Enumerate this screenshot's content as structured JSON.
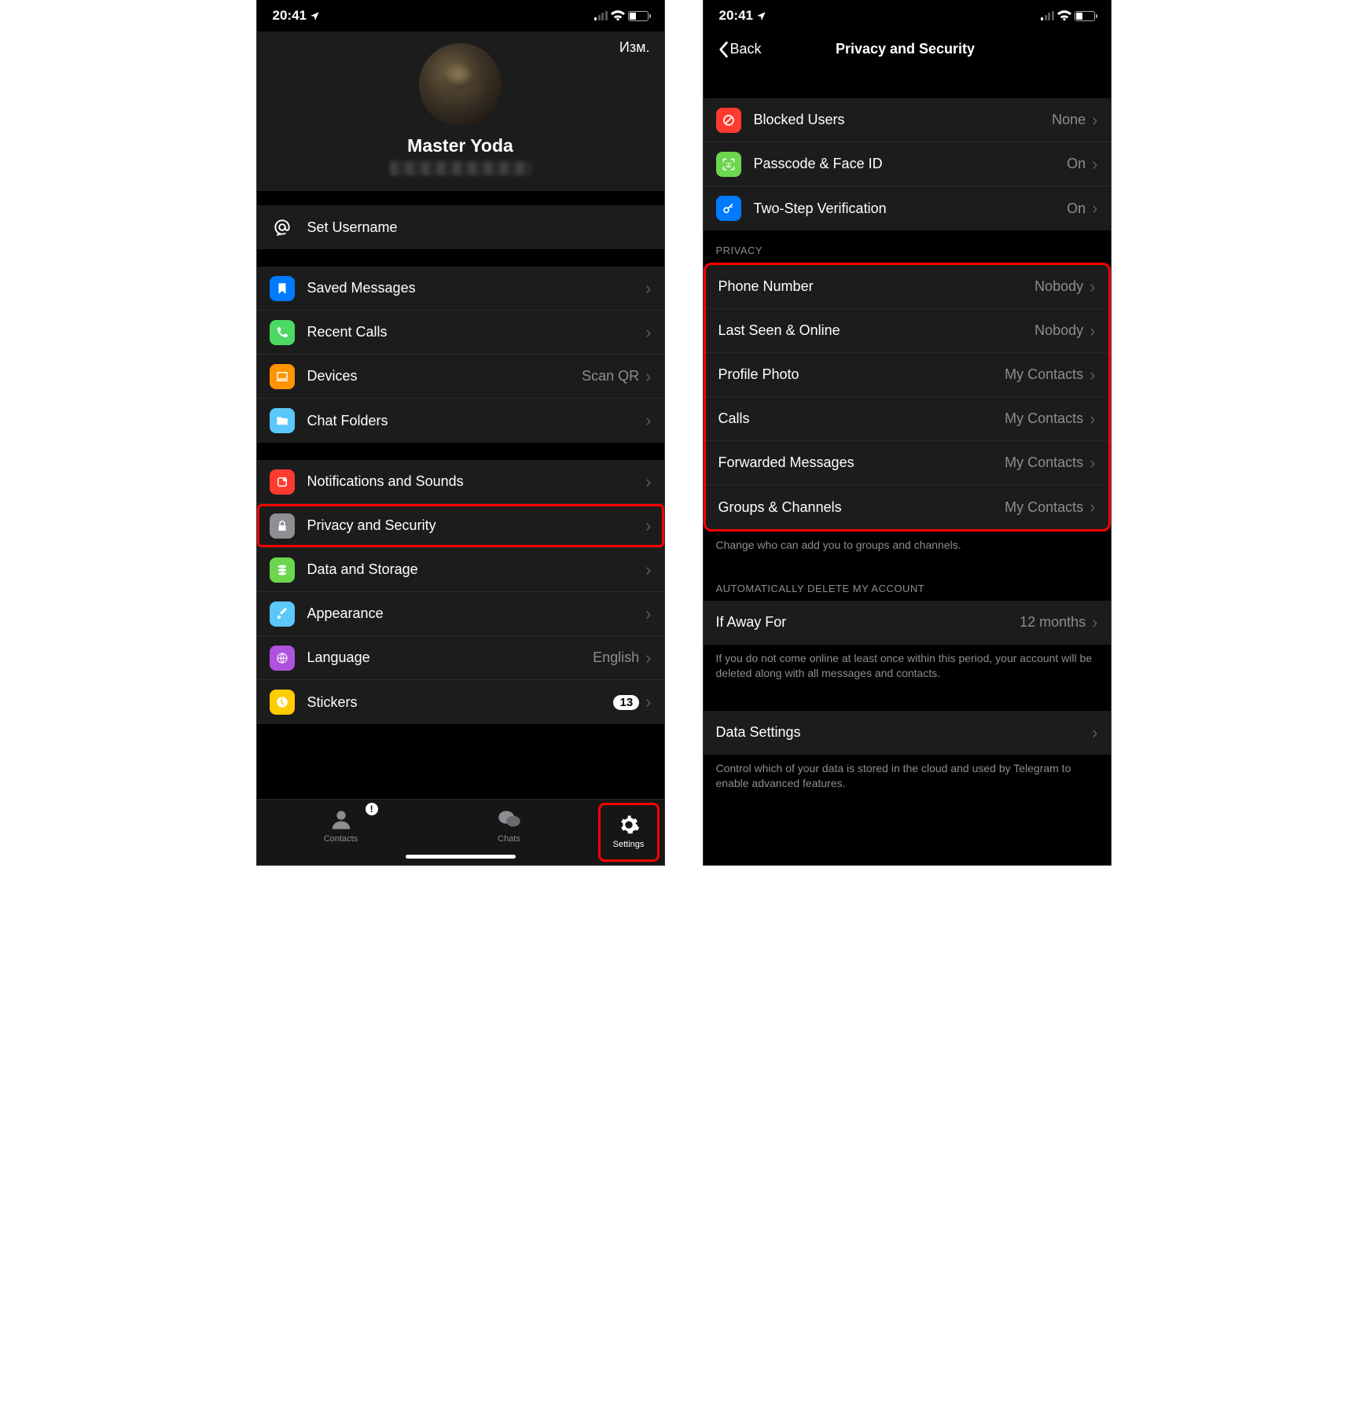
{
  "status": {
    "time": "20:41"
  },
  "left_screen": {
    "edit_label": "Изм.",
    "profile_name": "Master Yoda",
    "set_username": "Set Username",
    "group1": [
      {
        "icon": "bookmark-icon",
        "color": "bg-blue",
        "label": "Saved Messages"
      },
      {
        "icon": "phone-icon",
        "color": "bg-green",
        "label": "Recent Calls"
      },
      {
        "icon": "laptop-icon",
        "color": "bg-orange",
        "label": "Devices",
        "value": "Scan QR"
      },
      {
        "icon": "folder-icon",
        "color": "bg-cyan",
        "label": "Chat Folders"
      }
    ],
    "group2": [
      {
        "icon": "bell-icon",
        "color": "bg-red",
        "label": "Notifications and Sounds"
      },
      {
        "icon": "lock-icon",
        "color": "bg-gray",
        "label": "Privacy and Security",
        "highlight": true
      },
      {
        "icon": "database-icon",
        "color": "bg-lime",
        "label": "Data and Storage"
      },
      {
        "icon": "brush-icon",
        "color": "bg-cyan",
        "label": "Appearance"
      },
      {
        "icon": "globe-icon",
        "color": "bg-purple",
        "label": "Language",
        "value": "English"
      },
      {
        "icon": "pie-icon",
        "color": "bg-yellow",
        "label": "Stickers",
        "badge": "13"
      }
    ],
    "tabs": {
      "contacts": "Contacts",
      "chats": "Chats",
      "settings": "Settings"
    }
  },
  "right_screen": {
    "back_label": "Back",
    "title": "Privacy and Security",
    "group_security": [
      {
        "icon": "block-icon",
        "color": "bg-red",
        "label": "Blocked Users",
        "value": "None"
      },
      {
        "icon": "faceid-icon",
        "color": "bg-lime",
        "label": "Passcode & Face ID",
        "value": "On"
      },
      {
        "icon": "key-icon",
        "color": "bg-blue",
        "label": "Two-Step Verification",
        "value": "On"
      }
    ],
    "privacy_header": "PRIVACY",
    "group_privacy": [
      {
        "label": "Phone Number",
        "value": "Nobody"
      },
      {
        "label": "Last Seen & Online",
        "value": "Nobody"
      },
      {
        "label": "Profile Photo",
        "value": "My Contacts"
      },
      {
        "label": "Calls",
        "value": "My Contacts"
      },
      {
        "label": "Forwarded Messages",
        "value": "My Contacts"
      },
      {
        "label": "Groups & Channels",
        "value": "My Contacts"
      }
    ],
    "privacy_footer": "Change who can add you to groups and channels.",
    "autodelete_header": "AUTOMATICALLY DELETE MY ACCOUNT",
    "autodelete": {
      "label": "If Away For",
      "value": "12 months"
    },
    "autodelete_footer": "If you do not come online at least once within this period, your account will be deleted along with all messages and contacts.",
    "data_settings": {
      "label": "Data Settings"
    },
    "data_footer": "Control which of your data is stored in the cloud and used by Telegram to enable advanced features."
  }
}
